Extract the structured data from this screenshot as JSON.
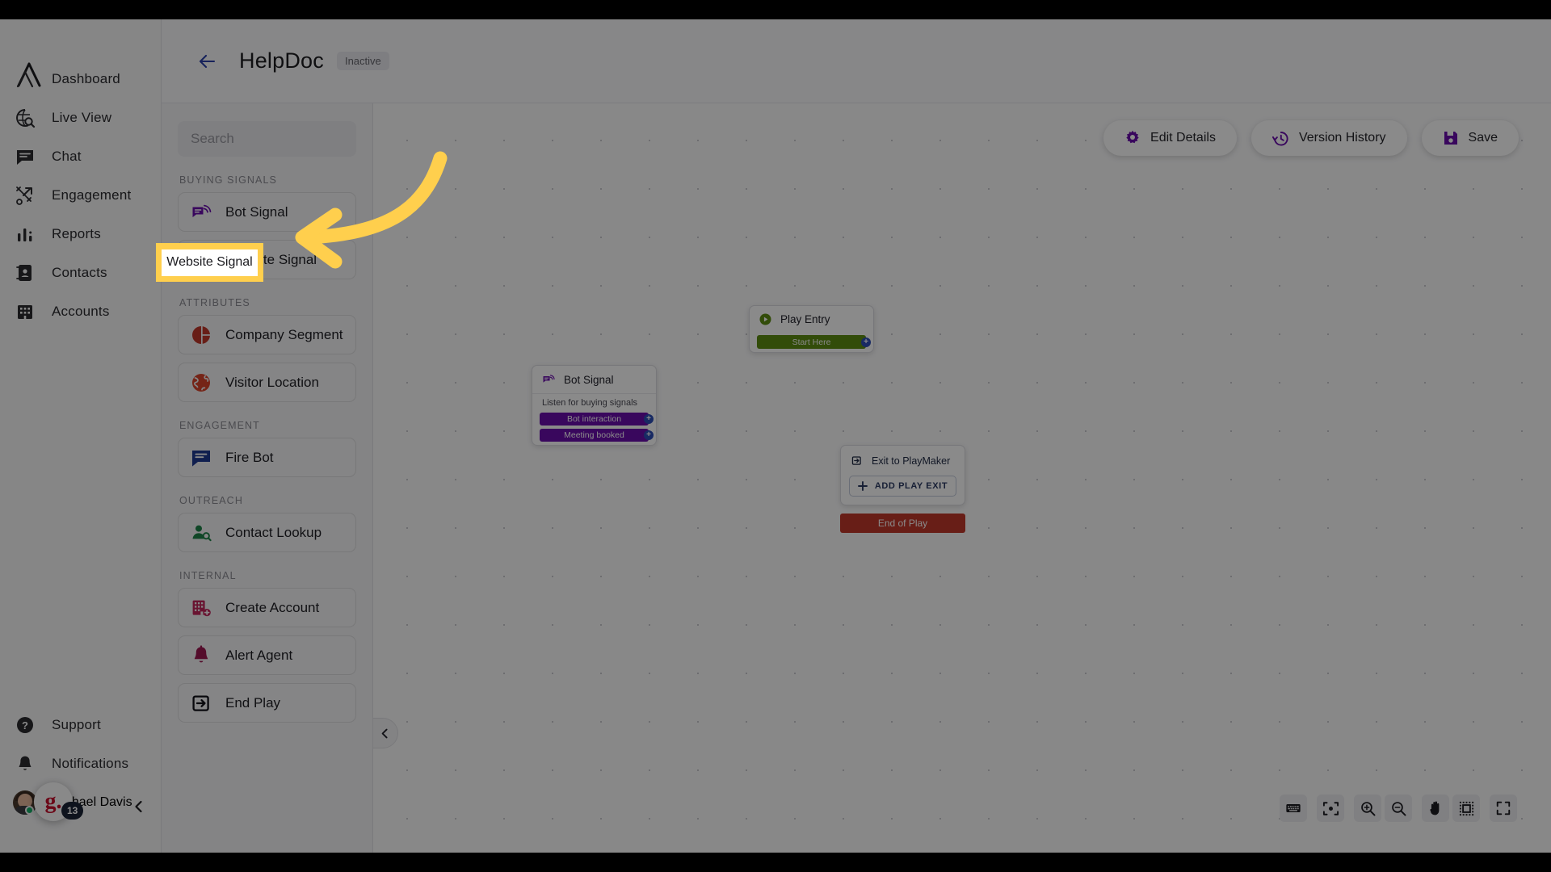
{
  "app": {
    "brand_logo": "lambda-logo-icon",
    "accent_purple": "#6a0dad",
    "highlight_yellow": "#ffcf4d"
  },
  "nav": {
    "items": [
      {
        "label": "Dashboard",
        "icon": "lambda-logo-icon"
      },
      {
        "label": "Live View",
        "icon": "globe-search-icon"
      },
      {
        "label": "Chat",
        "icon": "chat-bubble-icon"
      },
      {
        "label": "Engagement",
        "icon": "engagement-flow-icon"
      },
      {
        "label": "Reports",
        "icon": "bar-chart-icon"
      },
      {
        "label": "Contacts",
        "icon": "contact-card-icon"
      },
      {
        "label": "Accounts",
        "icon": "building-icon"
      }
    ],
    "bottom_items": [
      {
        "label": "Support",
        "icon": "question-circle-icon"
      },
      {
        "label": "Notifications",
        "icon": "bell-icon"
      }
    ],
    "user": {
      "name": "Michael Davis",
      "avatar": "user-avatar"
    },
    "collapse": "chevron-left-icon",
    "floating_badge": {
      "text": "g.",
      "count": "13"
    }
  },
  "header": {
    "back": "arrow-left-icon",
    "title": "HelpDoc",
    "status": "Inactive"
  },
  "actions": [
    {
      "label": "Edit Details",
      "icon": "gear-icon"
    },
    {
      "label": "Version History",
      "icon": "history-clock-icon"
    },
    {
      "label": "Save",
      "icon": "floppy-disk-icon"
    }
  ],
  "palette": {
    "search_placeholder": "Search",
    "search_value": "",
    "groups": [
      {
        "label": "BUYING SIGNALS",
        "items": [
          {
            "label": "Bot Signal",
            "icon": "bot-signal-icon",
            "color": "#6a0dad"
          },
          {
            "label": "Website Signal",
            "icon": "globe-icon",
            "color": "#6a0dad"
          }
        ]
      },
      {
        "label": "ATTRIBUTES",
        "items": [
          {
            "label": "Company Segment",
            "icon": "pie-chart-icon",
            "color": "#c0392b"
          },
          {
            "label": "Visitor Location",
            "icon": "globe-location-icon",
            "color": "#d9442b"
          }
        ]
      },
      {
        "label": "ENGAGEMENT",
        "items": [
          {
            "label": "Fire Bot",
            "icon": "chat-bubble-icon",
            "color": "#1f3a93"
          }
        ]
      },
      {
        "label": "OUTREACH",
        "items": [
          {
            "label": "Contact Lookup",
            "icon": "person-search-icon",
            "color": "#1e8449"
          }
        ]
      },
      {
        "label": "INTERNAL",
        "items": [
          {
            "label": "Create Account",
            "icon": "building-plus-icon",
            "color": "#c2255c"
          },
          {
            "label": "Alert Agent",
            "icon": "bell-icon",
            "color": "#9c1750"
          },
          {
            "label": "End Play",
            "icon": "exit-box-icon",
            "color": "#111118"
          }
        ]
      }
    ]
  },
  "canvas": {
    "panel_toggle": "chevron-left-icon",
    "nodes": {
      "play_entry": {
        "title": "Play Entry",
        "icon": "play-circle-icon",
        "pills": [
          {
            "label": "Start Here",
            "color": "#5d8c12"
          }
        ]
      },
      "bot_signal": {
        "title": "Bot Signal",
        "icon": "bot-signal-icon",
        "subtitle": "Listen for buying signals",
        "pills": [
          {
            "label": "Bot interaction",
            "color": "#6a0dad"
          },
          {
            "label": "Meeting booked",
            "color": "#6a0dad"
          }
        ]
      },
      "exit": {
        "row_label": "Exit to PlayMaker",
        "row_icon": "exit-box-icon",
        "add_label": "ADD PLAY EXIT",
        "add_icon": "plus-icon"
      },
      "end_of_play": {
        "label": "End of Play",
        "color": "#c0392b"
      }
    },
    "tools": [
      {
        "icon": "keyboard-icon"
      },
      {
        "icon": "recenter-icon"
      },
      {
        "icon": "zoom-in-icon"
      },
      {
        "icon": "zoom-out-icon"
      },
      {
        "icon": "hand-pan-icon"
      },
      {
        "icon": "select-box-icon"
      },
      {
        "icon": "fullscreen-icon"
      }
    ]
  },
  "annotation": {
    "highlight_label": "Website Signal",
    "arrow": "curved-arrow-left-icon",
    "arrow_color": "#ffcf4d"
  }
}
